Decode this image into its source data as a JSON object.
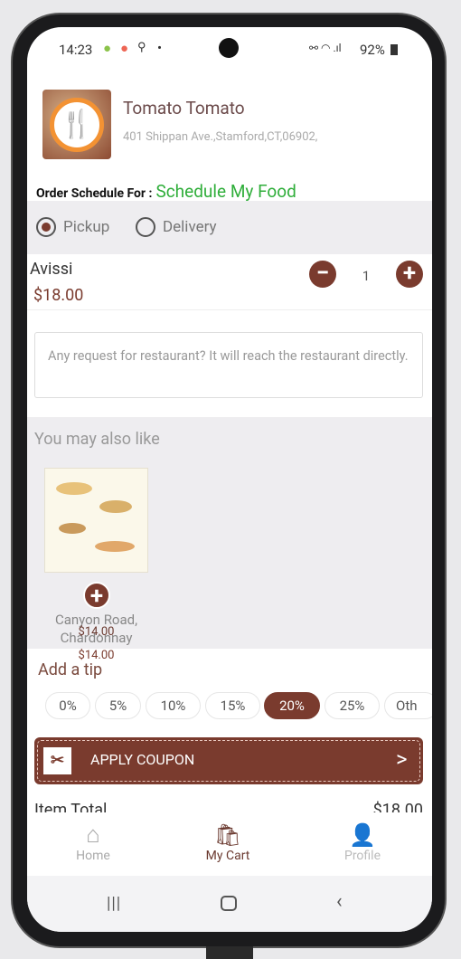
{
  "status": {
    "time": "14:23",
    "battery": "92%"
  },
  "restaurant": {
    "name": "Tomato Tomato",
    "address": "401 Shippan Ave.,Stamford,CT,06902,"
  },
  "schedule": {
    "label": "Order Schedule For :",
    "value": "Schedule My Food"
  },
  "order_type": {
    "options": [
      "Pickup",
      "Delivery"
    ],
    "selected": "Pickup"
  },
  "item": {
    "name": "Avissi",
    "price": "$18.00",
    "quantity": "1"
  },
  "request": {
    "placeholder": "Any request for restaurant? It will reach the restaurant directly."
  },
  "suggestions": {
    "title": "You may also like",
    "items": [
      {
        "name": "Canyon Road, Chardonnay",
        "price": "$14.00"
      }
    ]
  },
  "tip": {
    "title": "Add a tip",
    "options": [
      "0%",
      "5%",
      "10%",
      "15%",
      "20%",
      "25%",
      "Oth"
    ],
    "selected": "20%"
  },
  "coupon": {
    "label": "APPLY COUPON",
    "arrow": ">"
  },
  "totals": {
    "label": "Item Total",
    "value": "$18.00"
  },
  "nav": {
    "items": [
      {
        "label": "Home",
        "icon": "home-icon"
      },
      {
        "label": "My Cart",
        "icon": "cart-icon"
      },
      {
        "label": "Profile",
        "icon": "profile-icon"
      }
    ],
    "active": "My Cart"
  },
  "colors": {
    "accent": "#7a3b2e",
    "green": "#2fae3a",
    "section_gray": "#eeedf0"
  }
}
